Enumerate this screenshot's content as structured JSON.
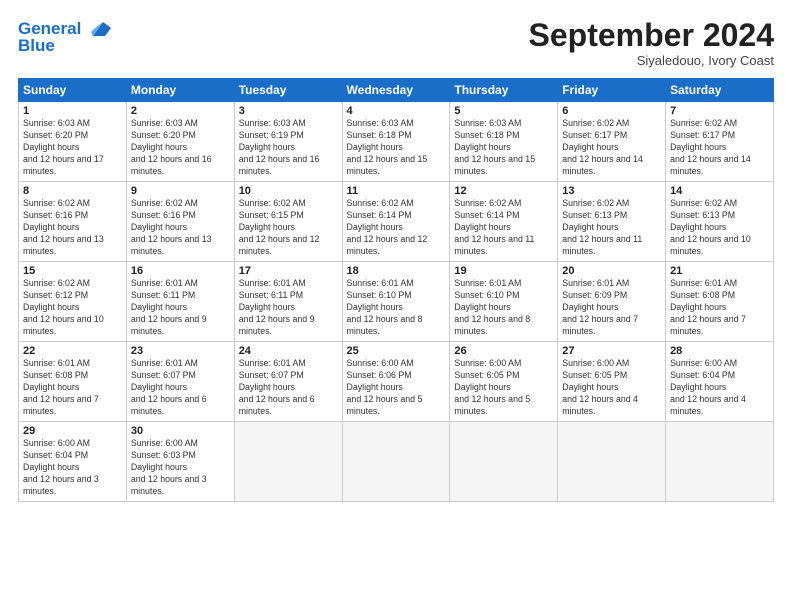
{
  "logo": {
    "line1": "General",
    "line2": "Blue"
  },
  "title": "September 2024",
  "subtitle": "Siyaledouo, Ivory Coast",
  "headers": [
    "Sunday",
    "Monday",
    "Tuesday",
    "Wednesday",
    "Thursday",
    "Friday",
    "Saturday"
  ],
  "weeks": [
    [
      {
        "day": "1",
        "rise": "6:03 AM",
        "set": "6:20 PM",
        "daylight": "12 hours and 17 minutes."
      },
      {
        "day": "2",
        "rise": "6:03 AM",
        "set": "6:20 PM",
        "daylight": "12 hours and 16 minutes."
      },
      {
        "day": "3",
        "rise": "6:03 AM",
        "set": "6:19 PM",
        "daylight": "12 hours and 16 minutes."
      },
      {
        "day": "4",
        "rise": "6:03 AM",
        "set": "6:18 PM",
        "daylight": "12 hours and 15 minutes."
      },
      {
        "day": "5",
        "rise": "6:03 AM",
        "set": "6:18 PM",
        "daylight": "12 hours and 15 minutes."
      },
      {
        "day": "6",
        "rise": "6:02 AM",
        "set": "6:17 PM",
        "daylight": "12 hours and 14 minutes."
      },
      {
        "day": "7",
        "rise": "6:02 AM",
        "set": "6:17 PM",
        "daylight": "12 hours and 14 minutes."
      }
    ],
    [
      {
        "day": "8",
        "rise": "6:02 AM",
        "set": "6:16 PM",
        "daylight": "12 hours and 13 minutes."
      },
      {
        "day": "9",
        "rise": "6:02 AM",
        "set": "6:16 PM",
        "daylight": "12 hours and 13 minutes."
      },
      {
        "day": "10",
        "rise": "6:02 AM",
        "set": "6:15 PM",
        "daylight": "12 hours and 12 minutes."
      },
      {
        "day": "11",
        "rise": "6:02 AM",
        "set": "6:14 PM",
        "daylight": "12 hours and 12 minutes."
      },
      {
        "day": "12",
        "rise": "6:02 AM",
        "set": "6:14 PM",
        "daylight": "12 hours and 11 minutes."
      },
      {
        "day": "13",
        "rise": "6:02 AM",
        "set": "6:13 PM",
        "daylight": "12 hours and 11 minutes."
      },
      {
        "day": "14",
        "rise": "6:02 AM",
        "set": "6:13 PM",
        "daylight": "12 hours and 10 minutes."
      }
    ],
    [
      {
        "day": "15",
        "rise": "6:02 AM",
        "set": "6:12 PM",
        "daylight": "12 hours and 10 minutes."
      },
      {
        "day": "16",
        "rise": "6:01 AM",
        "set": "6:11 PM",
        "daylight": "12 hours and 9 minutes."
      },
      {
        "day": "17",
        "rise": "6:01 AM",
        "set": "6:11 PM",
        "daylight": "12 hours and 9 minutes."
      },
      {
        "day": "18",
        "rise": "6:01 AM",
        "set": "6:10 PM",
        "daylight": "12 hours and 8 minutes."
      },
      {
        "day": "19",
        "rise": "6:01 AM",
        "set": "6:10 PM",
        "daylight": "12 hours and 8 minutes."
      },
      {
        "day": "20",
        "rise": "6:01 AM",
        "set": "6:09 PM",
        "daylight": "12 hours and 7 minutes."
      },
      {
        "day": "21",
        "rise": "6:01 AM",
        "set": "6:08 PM",
        "daylight": "12 hours and 7 minutes."
      }
    ],
    [
      {
        "day": "22",
        "rise": "6:01 AM",
        "set": "6:08 PM",
        "daylight": "12 hours and 7 minutes."
      },
      {
        "day": "23",
        "rise": "6:01 AM",
        "set": "6:07 PM",
        "daylight": "12 hours and 6 minutes."
      },
      {
        "day": "24",
        "rise": "6:01 AM",
        "set": "6:07 PM",
        "daylight": "12 hours and 6 minutes."
      },
      {
        "day": "25",
        "rise": "6:00 AM",
        "set": "6:06 PM",
        "daylight": "12 hours and 5 minutes."
      },
      {
        "day": "26",
        "rise": "6:00 AM",
        "set": "6:05 PM",
        "daylight": "12 hours and 5 minutes."
      },
      {
        "day": "27",
        "rise": "6:00 AM",
        "set": "6:05 PM",
        "daylight": "12 hours and 4 minutes."
      },
      {
        "day": "28",
        "rise": "6:00 AM",
        "set": "6:04 PM",
        "daylight": "12 hours and 4 minutes."
      }
    ],
    [
      {
        "day": "29",
        "rise": "6:00 AM",
        "set": "6:04 PM",
        "daylight": "12 hours and 3 minutes."
      },
      {
        "day": "30",
        "rise": "6:00 AM",
        "set": "6:03 PM",
        "daylight": "12 hours and 3 minutes."
      },
      null,
      null,
      null,
      null,
      null
    ]
  ]
}
